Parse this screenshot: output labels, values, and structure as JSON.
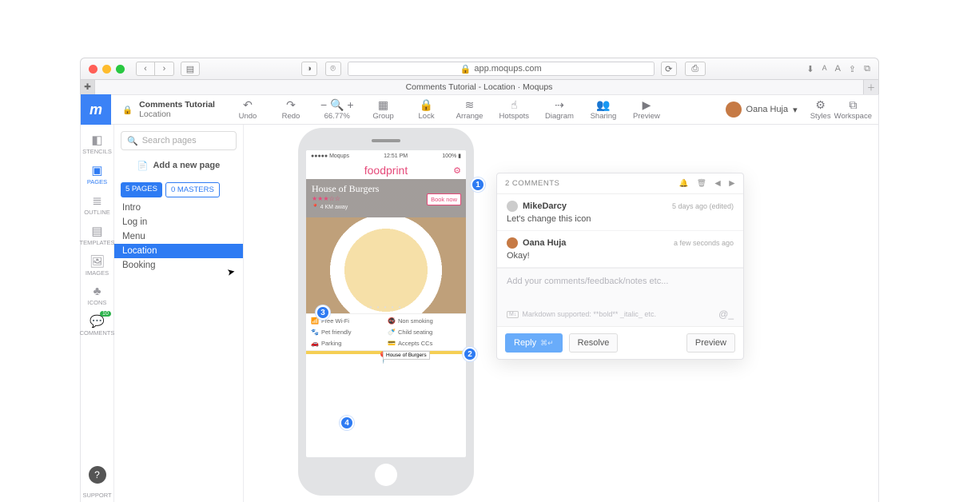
{
  "browser": {
    "url": "app.moqups.com",
    "tab_title": "Comments Tutorial - Location · Moqups"
  },
  "project": {
    "title": "Comments Tutorial",
    "subtitle": "Location"
  },
  "toolbar": {
    "undo": "Undo",
    "redo": "Redo",
    "zoom": "66.77%",
    "group": "Group",
    "lock": "Lock",
    "arrange": "Arrange",
    "hotspots": "Hotspots",
    "diagram": "Diagram",
    "sharing": "Sharing",
    "preview": "Preview",
    "styles": "Styles",
    "workspace": "Workspace",
    "user": "Oana Huja"
  },
  "rail": {
    "stencils": "STENCILS",
    "pages": "PAGES",
    "outline": "OUTLINE",
    "templates": "TEMPLATES",
    "images": "IMAGES",
    "icons": "ICONS",
    "comments": "COMMENTS",
    "support": "SUPPORT"
  },
  "sidebar": {
    "search_placeholder": "Search pages",
    "add_page": "Add a new page",
    "seg_pages": "5 PAGES",
    "seg_masters": "0 MASTERS",
    "pages": {
      "p0": "Intro",
      "p1": "Log in",
      "p2": "Menu",
      "p3": "Location",
      "p4": "Booking"
    }
  },
  "mock": {
    "carrier": "●●●●● Moqups",
    "time": "12:51 PM",
    "pct": "100%",
    "brand": "foodprint",
    "place": "House of Burgers",
    "distance": "4 KM away",
    "book": "Book now",
    "amen": {
      "a0": "Free Wi-Fi",
      "a1": "Non smoking",
      "a2": "Pet friendly",
      "a3": "Child seating",
      "a4": "Parking",
      "a5": "Accepts CCs"
    },
    "pin_label": "House of Burgers"
  },
  "markers": {
    "m1": "1",
    "m2": "2",
    "m3": "3",
    "m4": "4"
  },
  "popover": {
    "title": "2 COMMENTS",
    "c1_author": "MikeDarcy",
    "c1_time": "5 days ago (edited)",
    "c1_body": "Let's change this icon",
    "c2_author": "Oana Huja",
    "c2_time": "a few seconds ago",
    "c2_body": "Okay!",
    "placeholder": "Add your comments/feedback/notes etc...",
    "md_hint": "Markdown supported:   **bold** _italic_ etc.",
    "reply": "Reply",
    "reply_kbd": "⌘↵",
    "resolve": "Resolve",
    "preview": "Preview"
  }
}
